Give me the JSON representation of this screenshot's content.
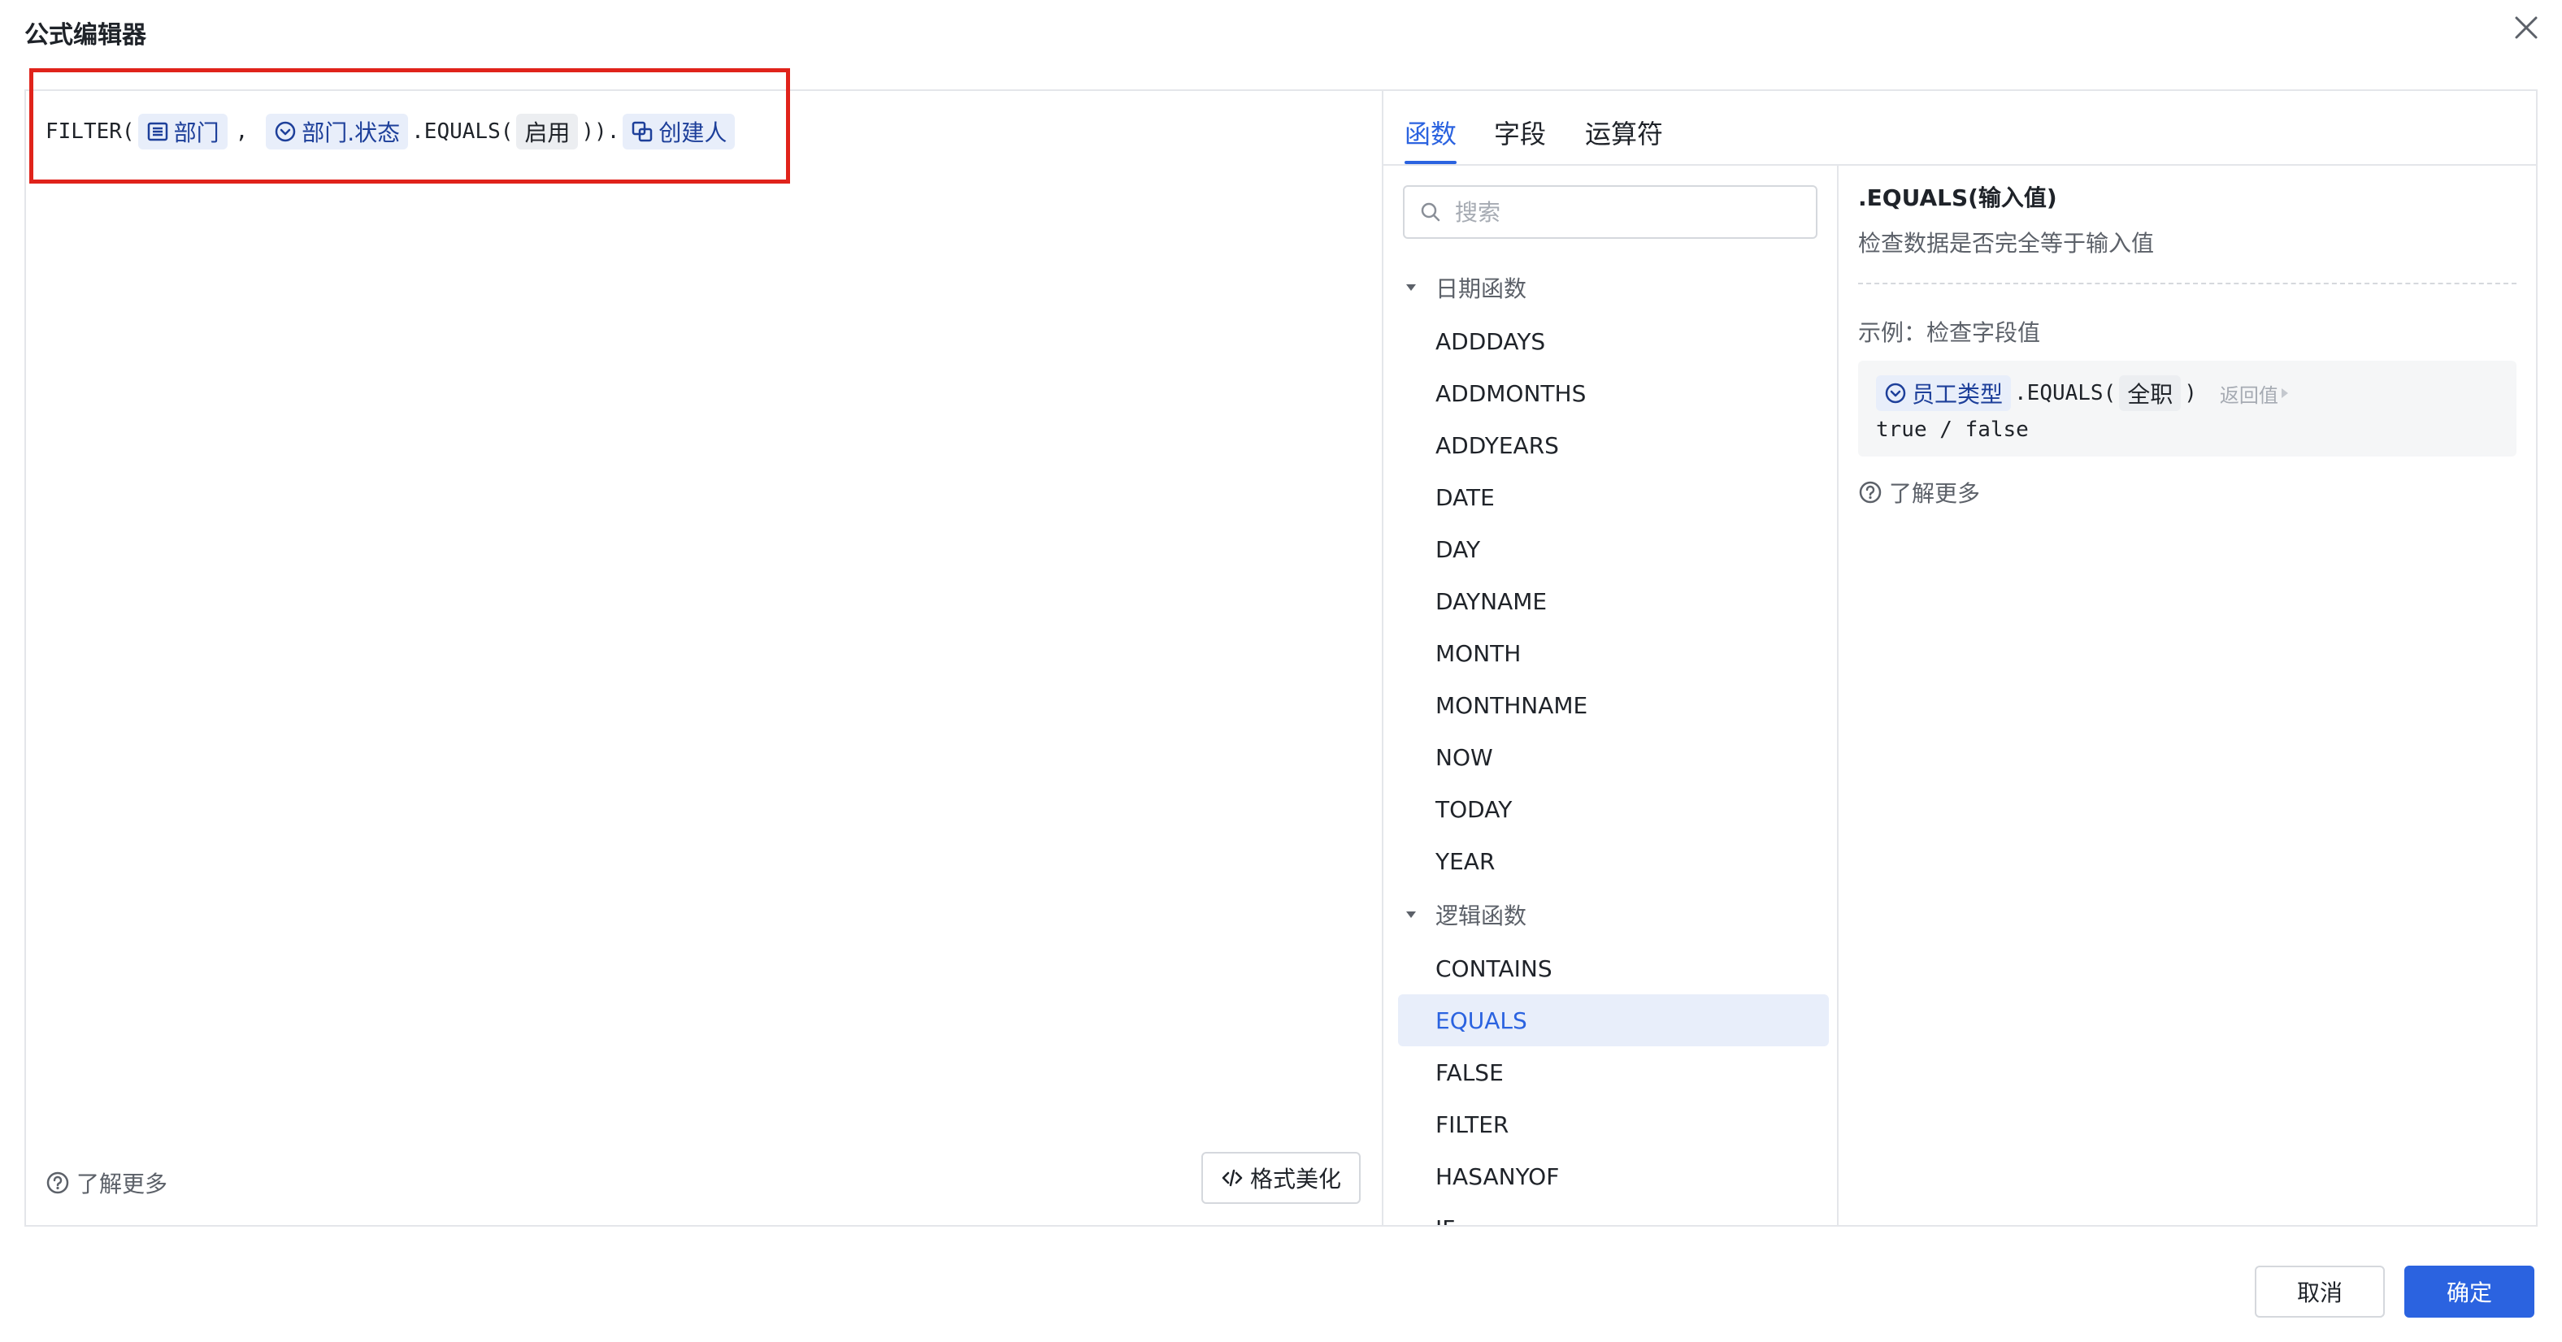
{
  "dialog": {
    "title": "公式编辑器"
  },
  "formula": {
    "fn_open": "FILTER(",
    "field_dept": "部门",
    "comma": ",",
    "field_dept_status": "部门.状态",
    "method_equals": ".EQUALS(",
    "value_enabled": "启用",
    "close_dot": ")).",
    "field_creator": "创建人"
  },
  "editor": {
    "learn_more": "了解更多",
    "beautify_label": "格式美化"
  },
  "tabs": [
    {
      "label": "函数",
      "active": true
    },
    {
      "label": "字段",
      "active": false
    },
    {
      "label": "运算符",
      "active": false
    }
  ],
  "search": {
    "placeholder": "搜索",
    "value": ""
  },
  "categories": [
    {
      "label": "日期函数",
      "items": [
        "ADDDAYS",
        "ADDMONTHS",
        "ADDYEARS",
        "DATE",
        "DAY",
        "DAYNAME",
        "MONTH",
        "MONTHNAME",
        "NOW",
        "TODAY",
        "YEAR"
      ]
    },
    {
      "label": "逻辑函数",
      "items": [
        "CONTAINS",
        "EQUALS",
        "FALSE",
        "FILTER",
        "HASANYOF",
        "IF"
      ]
    }
  ],
  "selected_function": "EQUALS",
  "detail": {
    "title": ".EQUALS(输入值)",
    "description": "检查数据是否完全等于输入值",
    "example_label": "示例：检查字段值",
    "example_field": "员工类型",
    "example_method": ".EQUALS(",
    "example_value": "全职",
    "example_close": ")",
    "return_label": "返回值",
    "result": "true / false",
    "learn_more": "了解更多"
  },
  "footer": {
    "cancel_label": "取消",
    "ok_label": "确定"
  },
  "colors": {
    "accent": "#2b63e0",
    "highlight_border": "#e0231b",
    "chip_bg": "#e8eefa",
    "chip_text": "#1d3f9a"
  }
}
